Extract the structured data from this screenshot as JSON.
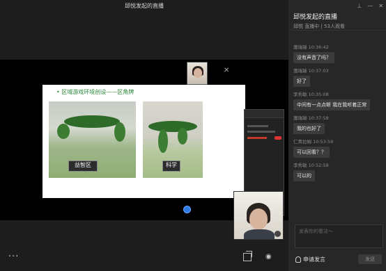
{
  "stage": {
    "title": "邱悦发起的直播",
    "slide_title": "• 区域游戏环境创设——区角牌",
    "sign_left": "益智区",
    "sign_right": "科学"
  },
  "panel": {
    "title": "邱悦发起的直播",
    "subtitle": "邱悦  直播中 | 53人观看",
    "messages": [
      {
        "sender": "蕭瑞瑞",
        "time": "10:36:42",
        "text": "没有声音了吗？"
      },
      {
        "sender": "蕭瑞瑞",
        "time": "10:37:03",
        "text": "好了"
      },
      {
        "sender": "李秀敏",
        "time": "10:35:08",
        "text": "中间有一点点断   我在我听着正常"
      },
      {
        "sender": "蕭瑞瑞",
        "time": "10:37:58",
        "text": "我的也好了"
      },
      {
        "sender": "仁青拉姆",
        "time": "10:53:59",
        "text": "可以回看？？"
      },
      {
        "sender": "李秀敏",
        "time": "10:52:58",
        "text": "可以的"
      }
    ],
    "input_placeholder": "发表你的看法～",
    "apply_label": "申请发言",
    "send_label": "发送"
  },
  "icons": {
    "more": "more-dots-icon",
    "layout": "layout-icon",
    "view": "eye-icon",
    "close": "close-icon",
    "mic": "mic-icon"
  },
  "colors": {
    "accent": "#2f7be6",
    "slide_title": "#2a8a3a"
  }
}
